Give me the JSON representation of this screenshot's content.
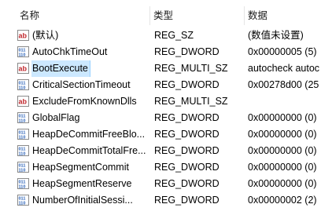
{
  "columns": {
    "name": "名称",
    "type": "类型",
    "data": "数据"
  },
  "rows": [
    {
      "name": "(默认)",
      "type": "REG_SZ",
      "data": "(数值未设置)",
      "icon": "string-value-icon",
      "selected": false
    },
    {
      "name": "AutoChkTimeOut",
      "type": "REG_DWORD",
      "data": "0x00000005 (5)",
      "icon": "binary-value-icon",
      "selected": false
    },
    {
      "name": "BootExecute",
      "type": "REG_MULTI_SZ",
      "data": "autocheck autoc",
      "icon": "string-value-icon",
      "selected": true
    },
    {
      "name": "CriticalSectionTimeout",
      "type": "REG_DWORD",
      "data": "0x00278d00 (25",
      "icon": "binary-value-icon",
      "selected": false
    },
    {
      "name": "ExcludeFromKnownDlls",
      "type": "REG_MULTI_SZ",
      "data": "",
      "icon": "string-value-icon",
      "selected": false
    },
    {
      "name": "GlobalFlag",
      "type": "REG_DWORD",
      "data": "0x00000000 (0)",
      "icon": "binary-value-icon",
      "selected": false
    },
    {
      "name": "HeapDeCommitFreeBlo...",
      "type": "REG_DWORD",
      "data": "0x00000000 (0)",
      "icon": "binary-value-icon",
      "selected": false
    },
    {
      "name": "HeapDeCommitTotalFre...",
      "type": "REG_DWORD",
      "data": "0x00000000 (0)",
      "icon": "binary-value-icon",
      "selected": false
    },
    {
      "name": "HeapSegmentCommit",
      "type": "REG_DWORD",
      "data": "0x00000000 (0)",
      "icon": "binary-value-icon",
      "selected": false
    },
    {
      "name": "HeapSegmentReserve",
      "type": "REG_DWORD",
      "data": "0x00000000 (0)",
      "icon": "binary-value-icon",
      "selected": false
    },
    {
      "name": "NumberOfInitialSessi...",
      "type": "REG_DWORD",
      "data": "0x00000002 (2)",
      "icon": "binary-value-icon",
      "selected": false
    }
  ],
  "colors": {
    "selection_fill": "#cce8ff",
    "selection_border": "#99d1ff",
    "string_icon_red": "#c0282d",
    "binary_icon_blue": "#2a62b8"
  }
}
